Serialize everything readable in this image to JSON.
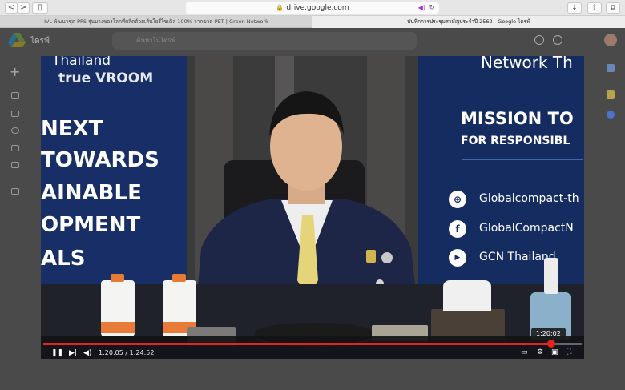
{
  "browser": {
    "url": "drive.google.com",
    "back_label": "<",
    "forward_label": ">",
    "sidebar_label": "▯",
    "download_label": "↓",
    "share_label": "⇧",
    "new_tab_label": "⧉",
    "tabs": [
      {
        "title": "IVL พัฒนาชุด PPS รุ่นบางของโลกที่ผลิตด้วยเส้นใยรีไซเคิล 100% จากขวด PET | Green Network",
        "active": false
      },
      {
        "title": "บันทึกการประชุมสามัญประจำปี 2562 - Google ไดรฟ์",
        "active": true
      }
    ]
  },
  "drive": {
    "title": "ไดรฟ์",
    "search_placeholder": "ค้นหาในไดรฟ์"
  },
  "video": {
    "left_banner": {
      "brand_line": "Thailand",
      "logo_text": "true VROOM",
      "lines": [
        "NEXT",
        "TOWARDS",
        "AINABLE",
        "OPMENT",
        "ALS"
      ]
    },
    "right_banner": {
      "header": "Network Th",
      "mission": "MISSION TO",
      "responsible": "FOR RESPONSIBL",
      "links": [
        {
          "icon": "globe-icon",
          "glyph": "⊕",
          "text": "Globalcompact-th"
        },
        {
          "icon": "facebook-icon",
          "glyph": "f",
          "text": "GlobalCompactN"
        },
        {
          "icon": "youtube-icon",
          "glyph": "▶",
          "text": "GCN Thailand"
        }
      ]
    }
  },
  "player": {
    "current_time": "1:20:05",
    "duration": "1:24:52",
    "time_separator": " / ",
    "hover_time": "1:20:02",
    "progress": 0.943,
    "colors": {
      "progress": "#e52222",
      "banner_blue": "#172f66"
    }
  }
}
